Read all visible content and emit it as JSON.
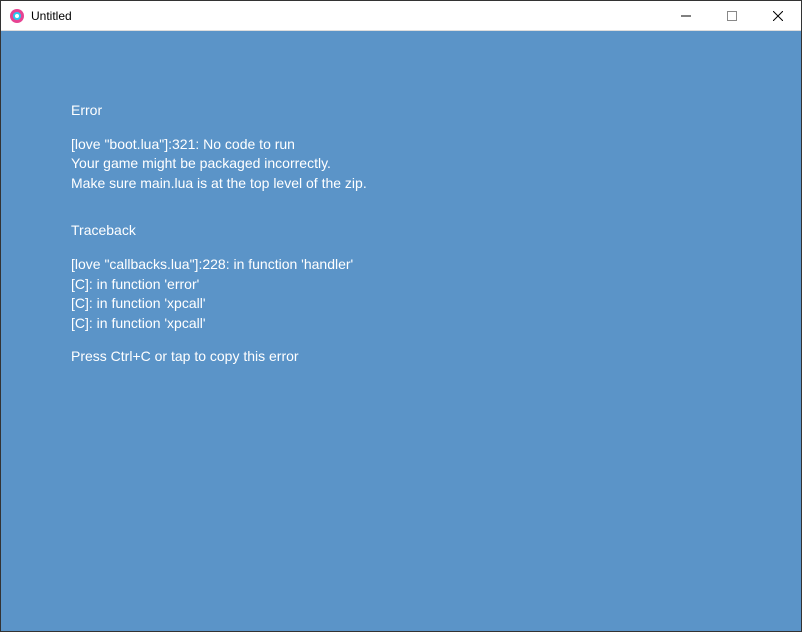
{
  "window": {
    "title": "Untitled"
  },
  "error": {
    "heading": "Error",
    "lines": [
      "[love \"boot.lua\"]:321: No code to run",
      "Your game might be packaged incorrectly.",
      "Make sure main.lua is at the top level of the zip."
    ]
  },
  "traceback": {
    "heading": "Traceback",
    "lines": [
      "[love \"callbacks.lua\"]:228: in function 'handler'",
      "[C]: in function 'error'",
      "[C]: in function 'xpcall'",
      "[C]: in function 'xpcall'"
    ]
  },
  "footer": {
    "copy_hint": "Press Ctrl+C or tap to copy this error"
  },
  "colors": {
    "background": "#5b94c8",
    "text": "#ffffff"
  }
}
